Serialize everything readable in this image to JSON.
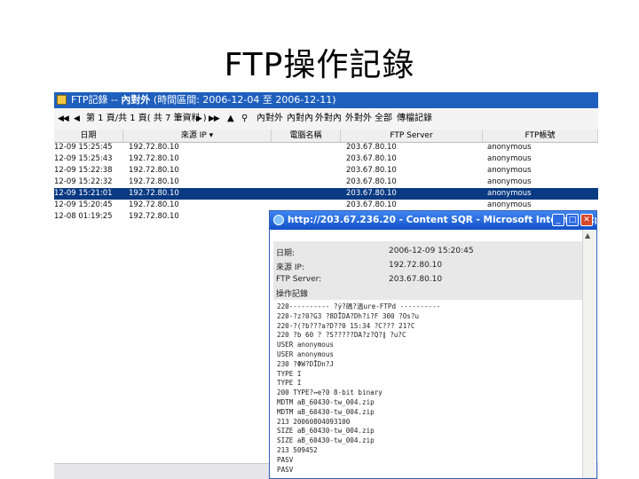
{
  "slide_title": "FTP操作記錄",
  "app": {
    "title_prefix": "FTP記錄 -- ",
    "title_bold": "內對外",
    "title_suffix": " (時間區間: 2006-12-04 至 2006-12-11)",
    "toolbar": {
      "first": "◀◀",
      "prev": "◀",
      "page_info": "第 1 頁/共 1 頁( 共 7 筆資料 )",
      "next": "▶",
      "last": "▶▶",
      "cursor_icon": "▲",
      "search_icon": "⚲",
      "filters": [
        "內對外",
        "內對內",
        "外對內",
        "外對外",
        "全部",
        "傳檔記錄"
      ]
    },
    "columns": [
      "日期",
      "來源 IP ▾",
      "電腦名稱",
      "FTP Server",
      "FTP帳號"
    ],
    "rows": [
      {
        "date": "12-09 15:25:45",
        "src": "192.72.80.10",
        "host": "",
        "server": "203.67.80.10",
        "account": "anonymous"
      },
      {
        "date": "12-09 15:25:43",
        "src": "192.72.80.10",
        "host": "",
        "server": "203.67.80.10",
        "account": "anonymous"
      },
      {
        "date": "12-09 15:22:38",
        "src": "192.72.80.10",
        "host": "",
        "server": "203.67.80.10",
        "account": "anonymous"
      },
      {
        "date": "12-09 15:22:32",
        "src": "192.72.80.10",
        "host": "",
        "server": "203.67.80.10",
        "account": "anonymous"
      },
      {
        "date": "12-09 15:21:01",
        "src": "192.72.80.10",
        "host": "",
        "server": "203.67.80.10",
        "account": "anonymous"
      },
      {
        "date": "12-09 15:20:45",
        "src": "192.72.80.10",
        "host": "",
        "server": "203.67.80.10",
        "account": "anonymous"
      },
      {
        "date": "12-08 01:19:25",
        "src": "192.72.80.10",
        "host": "",
        "server": "",
        "account": ""
      }
    ],
    "selected_row": 4,
    "colors": {
      "titlebar": "#1f5fbd",
      "selected": "#0a3a82"
    }
  },
  "popup": {
    "title": "http://203.67.236.20 - Content SQR - Microsoft Internet Explorer",
    "min": "_",
    "max": "□",
    "close": "✕",
    "scroll_up": "▲",
    "date_label": "日期:",
    "date_value": "2006-12-09 15:20:45",
    "src_label": "來源 IP:",
    "src_value": "192.72.80.10",
    "server_label": "FTP Server:",
    "server_value": "203.67.80.10",
    "log_label": "操作記錄",
    "log_lines": [
      "220---------- ?ý?碼?溫ure-FTPd ----------",
      "220-?z?0?G3 ?8DĪDA?Dh?i?F 300 ?Os?u",
      "220-?(?b???a?D??0 15:34 ?C??? 21?C",
      "220 ?b 60 ? ?S?????DA?z?Q?∥ ?u?C",
      "USER anonymous",
      "USER anonymous",
      "230 ?ΦW?DĪDn?J",
      "TYPE I",
      "TYPE I",
      "200 TYPE?↔e?0 8-bit binary",
      "MDTM aB_60430-tw_004.zip",
      "MDTM aB_60430-tw_004.zip",
      "213 20060804093100",
      "SIZE aB_60430-tw_004.zip",
      "SIZE aB_60430-tw_004.zip",
      "213 509452",
      "PASV",
      "PASV"
    ]
  }
}
